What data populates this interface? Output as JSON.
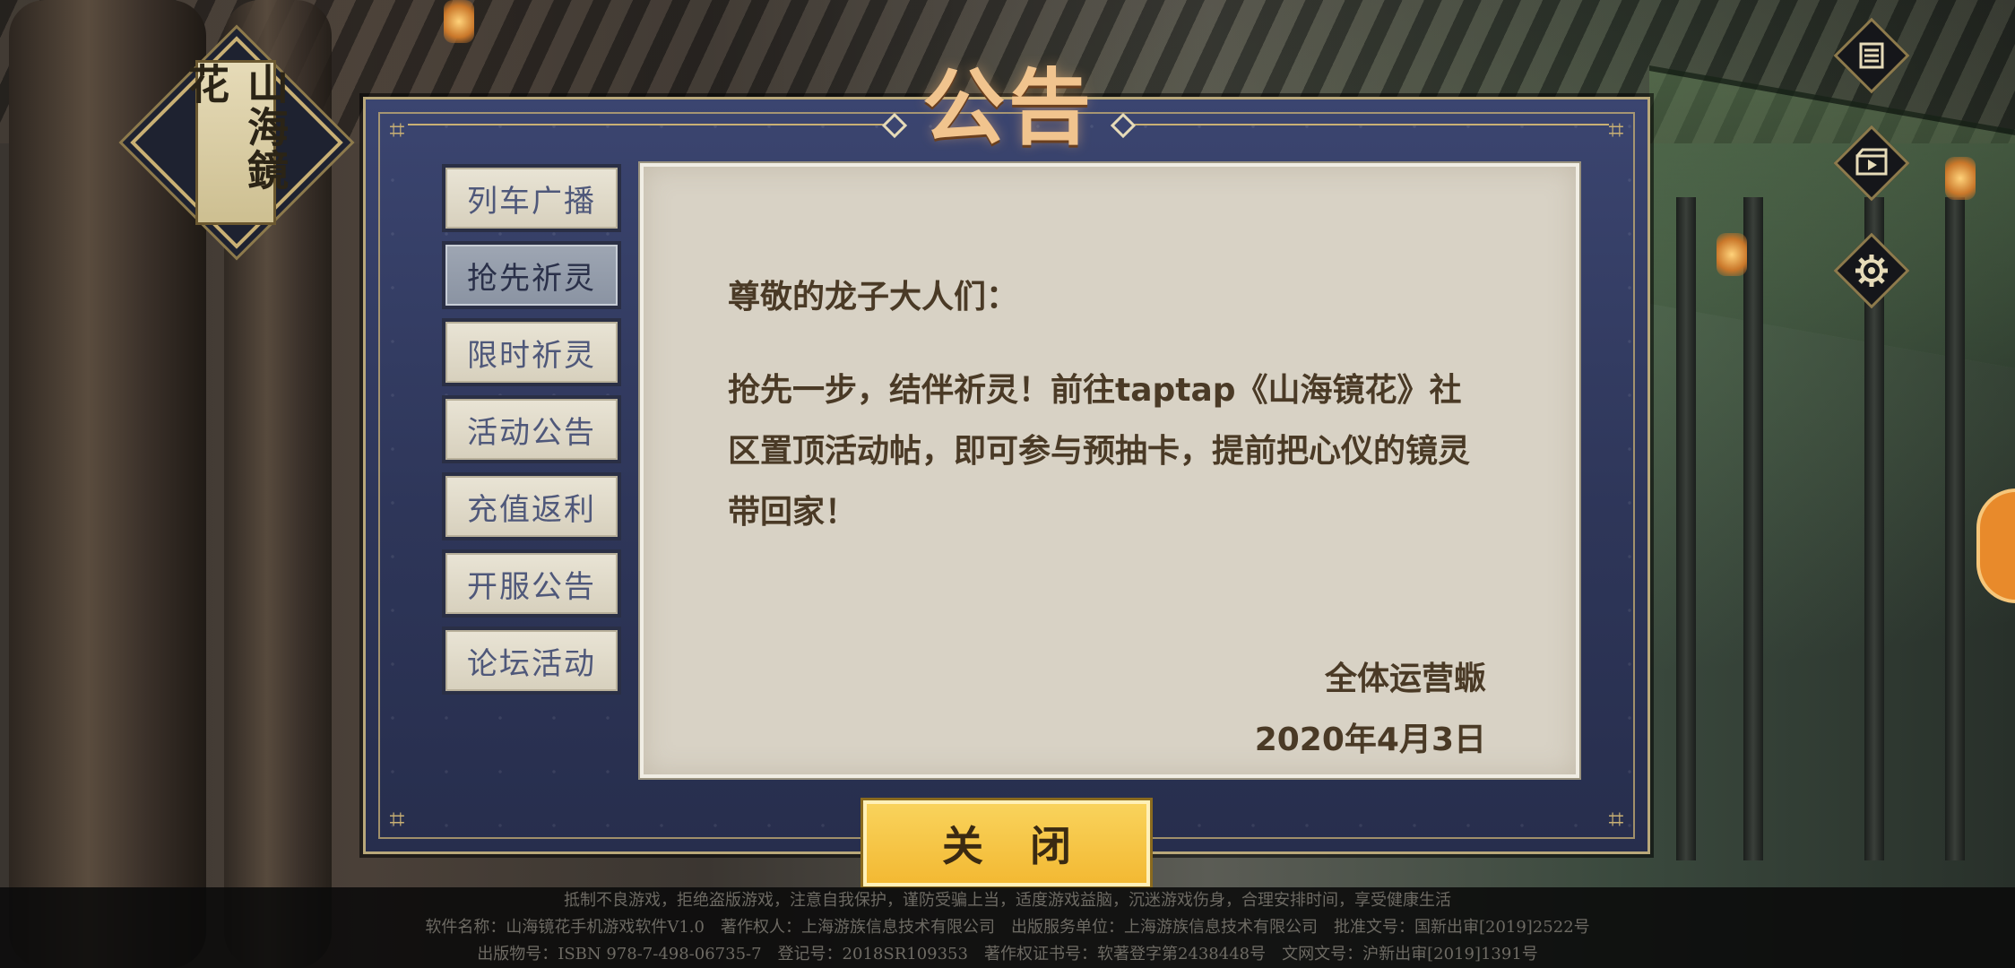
{
  "logo": {
    "text": "山海鏡花"
  },
  "dialog": {
    "title": "公告",
    "tabs": [
      {
        "label": "列车广播",
        "active": false
      },
      {
        "label": "抢先祈灵",
        "active": true
      },
      {
        "label": "限时祈灵",
        "active": false
      },
      {
        "label": "活动公告",
        "active": false
      },
      {
        "label": "充值返利",
        "active": false
      },
      {
        "label": "开服公告",
        "active": false
      },
      {
        "label": "论坛活动",
        "active": false
      }
    ],
    "content": {
      "greeting": "尊敬的龙子大人们：",
      "body": "抢先一步，结伴祈灵！前往taptap《山海镜花》社区置顶活动帖，即可参与预抽卡，提前把心仪的镜灵带回家！",
      "signature": "全体运营蝂",
      "date": "2020年4月3日"
    },
    "close_label": "关 闭"
  },
  "side_icons": [
    "notice-list-icon",
    "video-icon",
    "settings-gear-icon"
  ],
  "footer": {
    "line1": "抵制不良游戏，拒绝盗版游戏，注意自我保护，谨防受骗上当，适度游戏益脑，沉迷游戏伤身，合理安排时间，享受健康生活",
    "line2": "软件名称：山海镜花手机游戏软件V1.0　著作权人：上海游族信息技术有限公司　出版服务单位：上海游族信息技术有限公司　批准文号：国新出审[2019]2522号",
    "line3": "出版物号：ISBN 978-7-498-06735-7　登记号：2018SR109353　著作权证书号：软著登字第2438448号　文网文号：沪新出审[2019]1391号"
  },
  "colors": {
    "dialog_bg": "#2e3659",
    "gold": "#c9b074",
    "panel_bg": "#d8d2c5",
    "text_brown": "#4a3a26",
    "button_yellow": "#f3b933",
    "tab_active": "#8a93a2"
  }
}
